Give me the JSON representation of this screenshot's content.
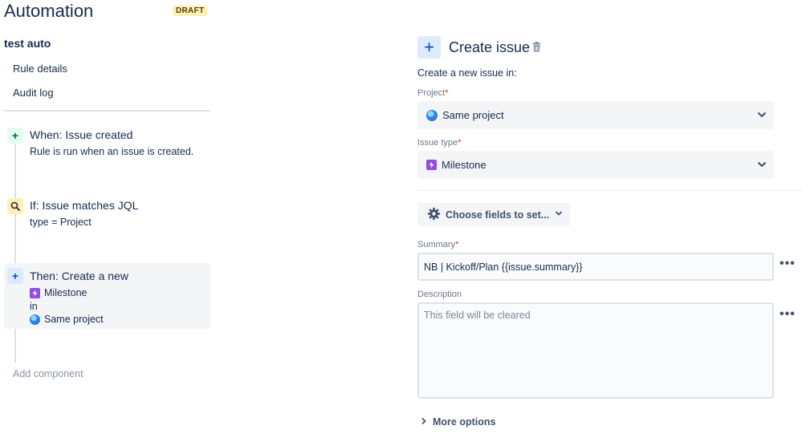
{
  "header": {
    "title": "Automation",
    "badge": "DRAFT"
  },
  "sidebar": {
    "rule_name": "test auto",
    "nav": [
      {
        "label": "Rule details"
      },
      {
        "label": "Audit log"
      }
    ],
    "add_component": "Add component"
  },
  "steps": {
    "when": {
      "icon": "+",
      "title": "When: Issue created",
      "desc": "Rule is run when an issue is created."
    },
    "if": {
      "icon": "search-icon",
      "title": "If: Issue matches JQL",
      "desc": "type = Project"
    },
    "then": {
      "icon": "+",
      "title": "Then: Create a new",
      "issue_type": "Milestone",
      "in": "in",
      "project": "Same project"
    }
  },
  "action": {
    "icon": "+",
    "title": "Create issue",
    "create_in": "Create a new issue in:",
    "project": {
      "label": "Project",
      "required": "*",
      "value": "Same project"
    },
    "issue_type": {
      "label": "Issue type",
      "required": "*",
      "value": "Milestone"
    },
    "choose_fields": "Choose fields to set...",
    "summary": {
      "label": "Summary",
      "required": "*",
      "value": "NB | Kickoff/Plan {{issue.summary}}"
    },
    "description": {
      "label": "Description",
      "placeholder": "This field will be cleared"
    },
    "more_options": "More options"
  },
  "colors": {
    "accent": "#0052cc",
    "milestone": "#904ee2",
    "required": "#de350b",
    "draft_bg": "#fff0b3"
  }
}
